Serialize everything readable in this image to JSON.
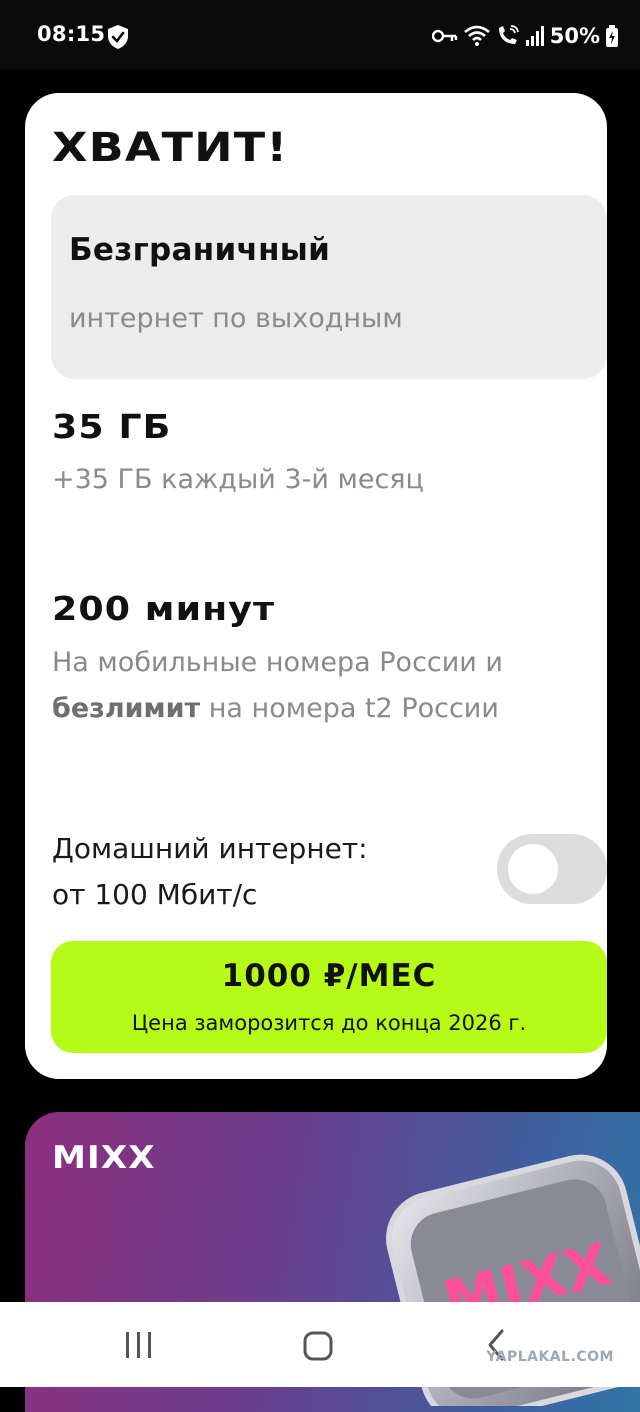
{
  "status_bar": {
    "time": "08:15",
    "battery": "50%"
  },
  "tariff_card": {
    "title": "ХВАТИТ!",
    "feature": {
      "title": "Безграничный",
      "subtitle": "интернет по выходным"
    },
    "data_block": {
      "title": "35 ГБ",
      "subtitle": "+35 ГБ каждый 3-й месяц"
    },
    "minutes_block": {
      "title": "200 минут",
      "line1": "На мобильные номера России и",
      "line2_bold": "безлимит",
      "line2_rest": " на номера t2 России"
    },
    "home_internet": {
      "line1": "Домашний интернет:",
      "line2": "от 100 Мбит/с",
      "toggle_on": false
    },
    "price": {
      "main": "1000 ₽/МЕС",
      "note": "Цена заморозится до конца 2026 г."
    }
  },
  "promo_card": {
    "title": "MIXX",
    "logo_text": "MIXX"
  },
  "watermark": "YAPLAKAL.COM",
  "colors": {
    "accent": "#b6fb17",
    "card_bg": "#ffffff",
    "feature_bg": "#ececec"
  }
}
